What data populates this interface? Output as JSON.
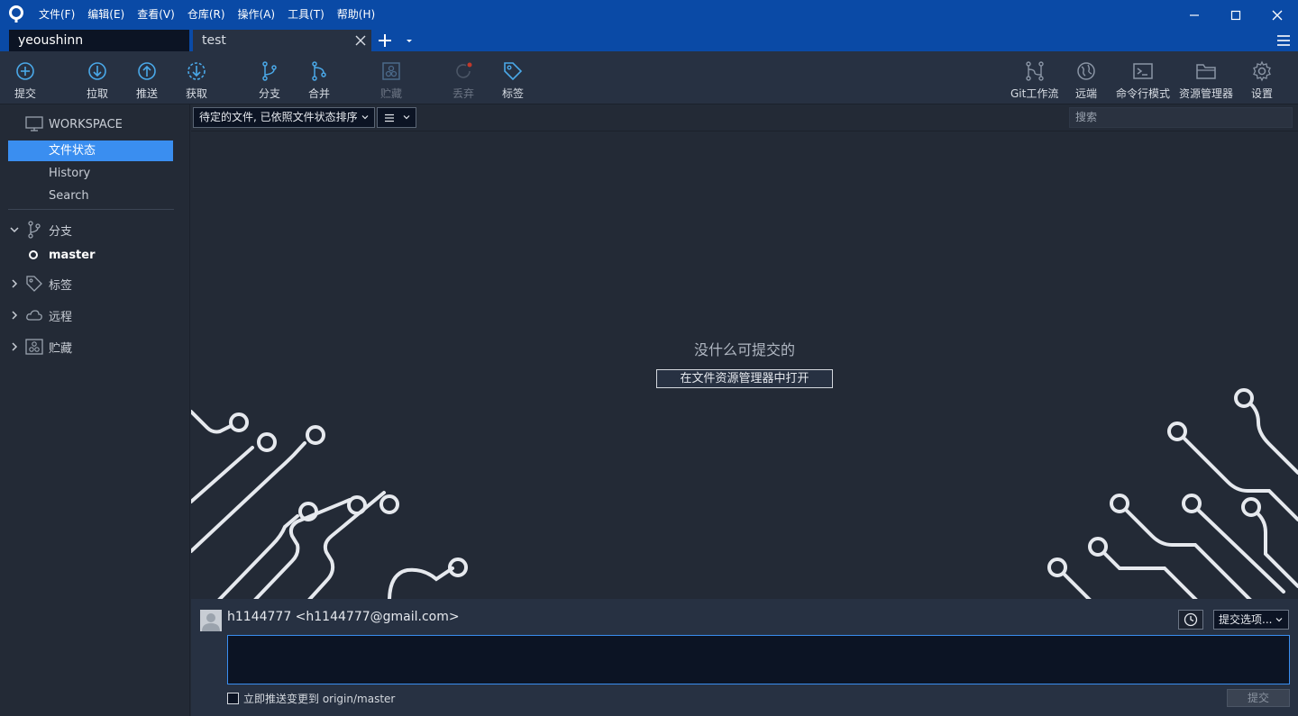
{
  "menu": [
    "文件(F)",
    "编辑(E)",
    "查看(V)",
    "仓库(R)",
    "操作(A)",
    "工具(T)",
    "帮助(H)"
  ],
  "tabs": {
    "home": "yeoushinn",
    "repo": "test"
  },
  "toolbar": {
    "commit": "提交",
    "pull": "拉取",
    "push": "推送",
    "fetch": "获取",
    "branch": "分支",
    "merge": "合并",
    "stash": "贮藏",
    "discard": "丢弃",
    "tag": "标签",
    "gitflow": "Git工作流",
    "remote": "远端",
    "terminal": "命令行模式",
    "explorer": "资源管理器",
    "settings": "设置"
  },
  "sidebar": {
    "workspace": "WORKSPACE",
    "items": [
      "文件状态",
      "History",
      "Search"
    ],
    "groups": {
      "branches": "分支",
      "current_branch": "master",
      "tags": "标签",
      "remotes": "远程",
      "stashes": "贮藏"
    }
  },
  "filter": {
    "sort": "待定的文件, 已依照文件状态排序",
    "search_placeholder": "搜索"
  },
  "main": {
    "empty_title": "没什么可提交的",
    "open_button": "在文件资源管理器中打开"
  },
  "commit_panel": {
    "author": "h1144777 <h1144777@gmail.com>",
    "options": "提交选项...",
    "push_immediately": "立即推送变更到 origin/master",
    "commit_button": "提交"
  },
  "colors": {
    "titlebar": "#0a4aa6",
    "accent": "#3a8ef0",
    "toolbar_icon": "#4aa8e8"
  }
}
